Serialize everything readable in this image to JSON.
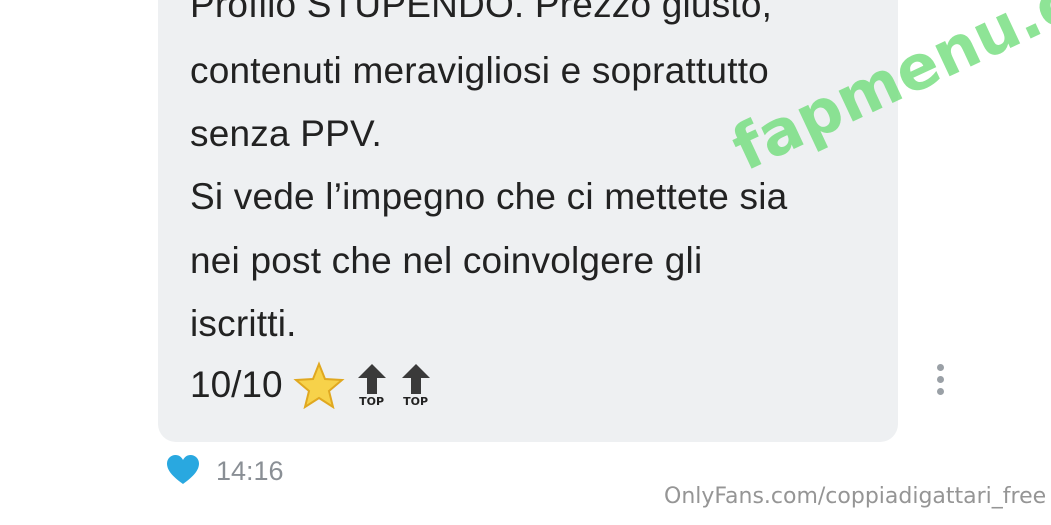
{
  "message": {
    "lines": [
      "Profilo STUPENDO. Prezzo giusto,",
      "contenuti meravigliosi e soprattutto",
      "senza PPV.",
      "Si vede l’impegno che ci mettete sia",
      "nei post che nel coinvolgere gli",
      "iscritti."
    ],
    "rating": "10/10",
    "top_label": "TOP",
    "icons": [
      "star-icon",
      "top-arrow-icon",
      "top-arrow-icon"
    ]
  },
  "meta": {
    "time": "14:16",
    "reaction_icon": "heart-icon",
    "more_icon": "more-vertical-icon"
  },
  "watermarks": {
    "site": "fapmenu.com",
    "source": "OnlyFans.com/coppiadigattari_free"
  },
  "colors": {
    "bubble": "#eef0f2",
    "heart": "#29a8e0",
    "watermark_green": "#6edc78"
  }
}
